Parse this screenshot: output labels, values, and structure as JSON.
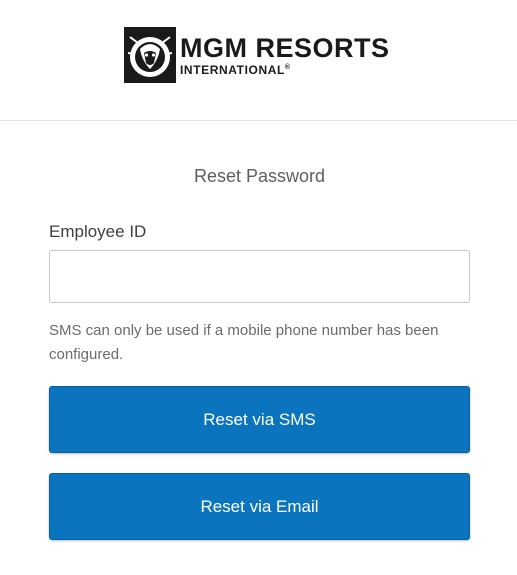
{
  "header": {
    "logo_main": "MGM RESORTS",
    "logo_sub": "INTERNATIONAL",
    "logo_registered": "®",
    "logo_icon": "lion-head-icon"
  },
  "form": {
    "title": "Reset Password",
    "employee_id_label": "Employee ID",
    "employee_id_value": "",
    "employee_id_placeholder": "",
    "hint": "SMS can only be used if a mobile phone number has been configured.",
    "sms_button_label": "Reset via SMS",
    "email_button_label": "Reset via Email"
  },
  "colors": {
    "button": "#0a74be",
    "text": "#5d5d5d",
    "logo": "#1a1a1a"
  }
}
